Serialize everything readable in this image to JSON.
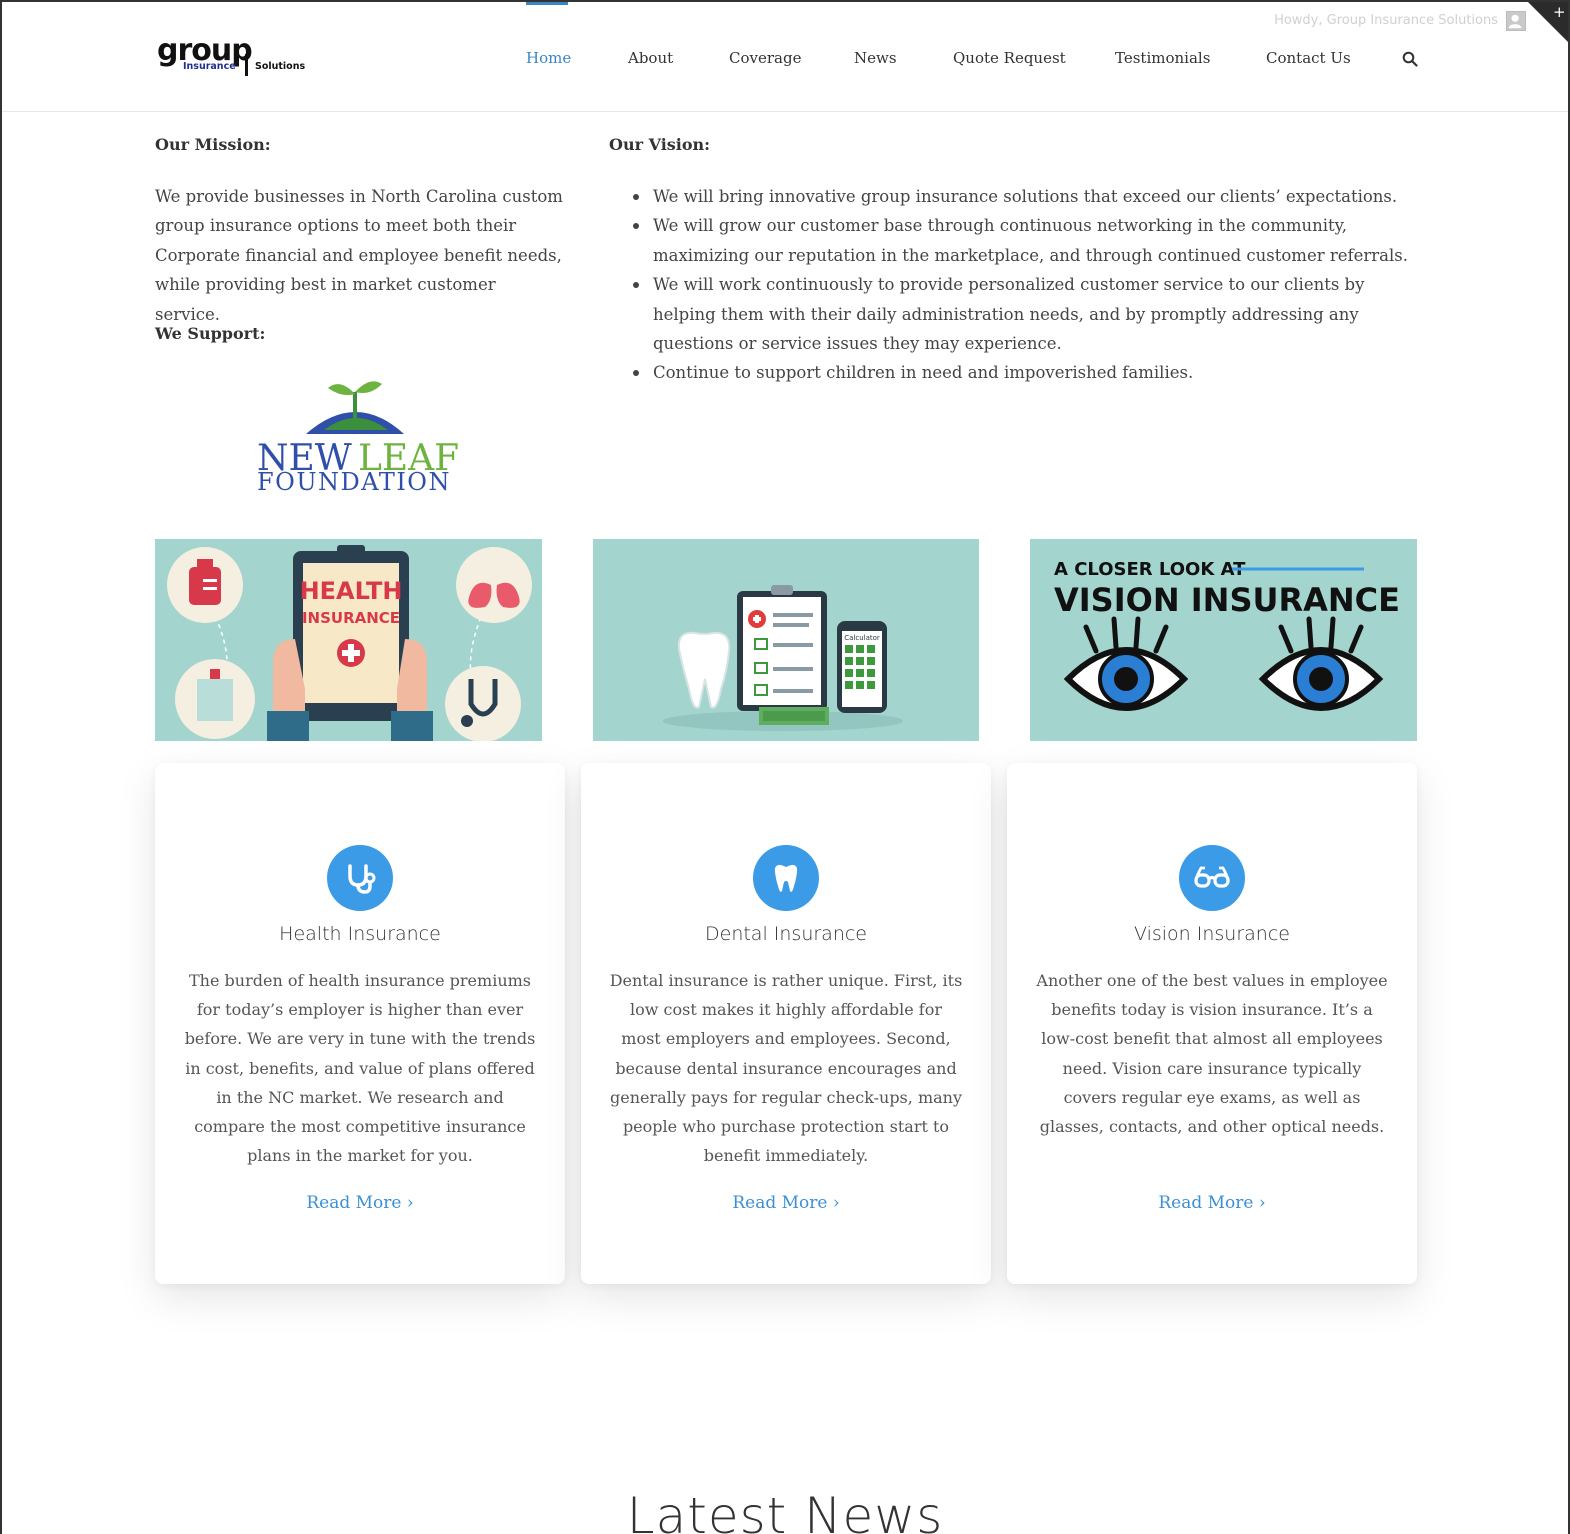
{
  "header": {
    "logo_text": "group",
    "logo_sub1": "Insurance",
    "logo_sub2": "Solutions",
    "howdy": "Howdy, Group Insurance Solutions",
    "nav": [
      "Home",
      "About",
      "Coverage",
      "News",
      "Quote Request",
      "Testimonials",
      "Contact Us"
    ],
    "active_color": "#3a86c4"
  },
  "mission": {
    "heading": "Our Mission:",
    "text": "We provide businesses in North Carolina custom group insurance options to meet both their Corporate financial and employee benefit needs, while providing best in market customer service.",
    "support_heading": "We Support:",
    "support_logo_line1_a": "NEW",
    "support_logo_line1_b": "LEAF",
    "support_logo_line2": "FOUNDATION"
  },
  "vision": {
    "heading": "Our Vision:",
    "items": [
      "We will bring innovative group insurance solutions that exceed our clients’ expectations.",
      "We will grow our customer base through continuous networking in the community, maximizing our reputation in the marketplace, and through continued customer referrals.",
      "We will work continuously to provide personalized customer service to our clients by helping them with their daily administration needs, and by promptly addressing any questions or service issues they may experience.",
      "Continue to support children in need and impoverished families."
    ]
  },
  "promos": {
    "health_line1": "HEALTH",
    "health_line2": "INSURANCE",
    "dental_calc": "Calculator",
    "vision_line1": "A CLOSER LOOK AT",
    "vision_line2": "VISION INSURANCE",
    "bg_color": "#a3d4ce"
  },
  "cards": [
    {
      "icon": "stethoscope-icon",
      "title": "Health Insurance",
      "text": "The burden of health insurance premiums for today’s employer is higher than ever before. We are very in tune with the trends in cost, benefits, and value of plans offered in the NC market. We research and compare the most competitive insurance plans in the market for you.",
      "link": "Read More ›"
    },
    {
      "icon": "tooth-icon",
      "title": "Dental Insurance",
      "text": "Dental insurance is rather unique. First, its low cost makes it highly affordable for most employers and employees. Second, because dental insurance encourages and generally pays for regular check-ups, many people who purchase protection start to benefit immediately.",
      "link": "Read More ›"
    },
    {
      "icon": "glasses-icon",
      "title": "Vision Insurance",
      "text": "Another one of the best values in employee benefits today is vision insurance. It’s a low-cost benefit that almost all employees need. Vision care insurance typically covers regular eye exams, as well as glasses, contacts, and other optical needs.",
      "link": "Read More ›"
    }
  ],
  "latest_news": "Latest News",
  "accent_color": "#3b9be6"
}
